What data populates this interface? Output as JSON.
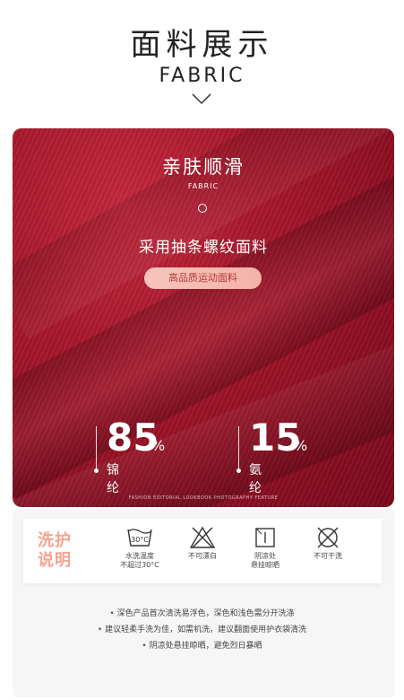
{
  "header": {
    "title": "面料展示",
    "subtitle": "FABRIC"
  },
  "fabric": {
    "title": "亲肤顺滑",
    "subtitle": "FABRIC",
    "description": "采用抽条螺纹面料",
    "pill_label": "高品质运动面料",
    "stats": [
      {
        "number": "85",
        "unit": "%",
        "label": "锦纶"
      },
      {
        "number": "15",
        "unit": "%",
        "label": "氨纶"
      }
    ],
    "credit": "FASHION EDITORIAL LOOKBOOK PHOTOGRAPHY FEATURE",
    "colors": {
      "fabric": "#a8182c",
      "pill": "#f6bdb4"
    }
  },
  "care": {
    "title": "洗护说明",
    "items": [
      {
        "icon": "wash-30-icon",
        "line1": "水洗温度",
        "line2": "不超过30°C",
        "icon_text": "30°C"
      },
      {
        "icon": "no-bleach-icon",
        "line1": "不可漂白",
        "line2": ""
      },
      {
        "icon": "line-dry-shade-icon",
        "line1": "阴凉处",
        "line2": "悬挂晾晒"
      },
      {
        "icon": "no-dry-clean-icon",
        "line1": "不可干洗",
        "line2": ""
      }
    ]
  },
  "tips": [
    "深色产品首次清洗易浮色，深色和浅色需分开洗涤",
    "建议轻柔手洗为佳，如需机洗，建议翻面使用护衣袋清洗",
    "阴凉处悬挂晾晒，避免烈日暴晒"
  ]
}
